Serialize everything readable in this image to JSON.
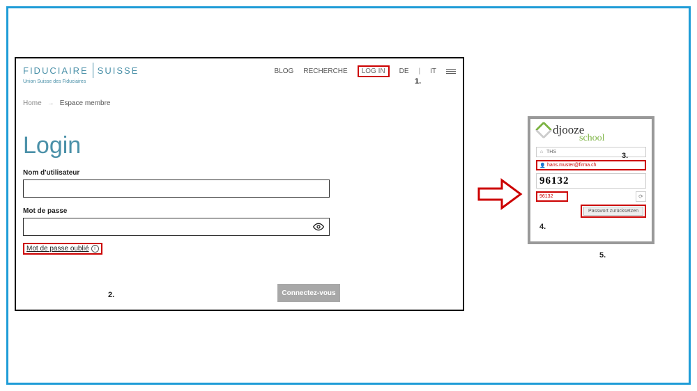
{
  "left": {
    "logo": {
      "l": "FIDUCIAIRE",
      "r": "SUISSE",
      "sub": "Union Suisse des Fiduciaires"
    },
    "nav": {
      "blog": "BLOG",
      "search": "RECHERCHE",
      "login": "LOG IN",
      "de": "DE",
      "it": "IT"
    },
    "breadcrumb": {
      "home": "Home",
      "current": "Espace membre"
    },
    "title": "Login",
    "user_label": "Nom d'utilisateur",
    "pass_label": "Mot de passe",
    "forgot": "Mot de passe oublié",
    "submit": "Connectez-vous"
  },
  "right": {
    "logo": {
      "main": "djooze",
      "sub": "school"
    },
    "org": "THS",
    "email": "hans.muster@firma.ch",
    "captcha_img": "96132",
    "captcha_val": "96132",
    "reset": "Passwort zurücksetzen"
  },
  "callouts": {
    "c1": "1.",
    "c2": "2.",
    "c3": "3.",
    "c4": "4.",
    "c5": "5."
  }
}
